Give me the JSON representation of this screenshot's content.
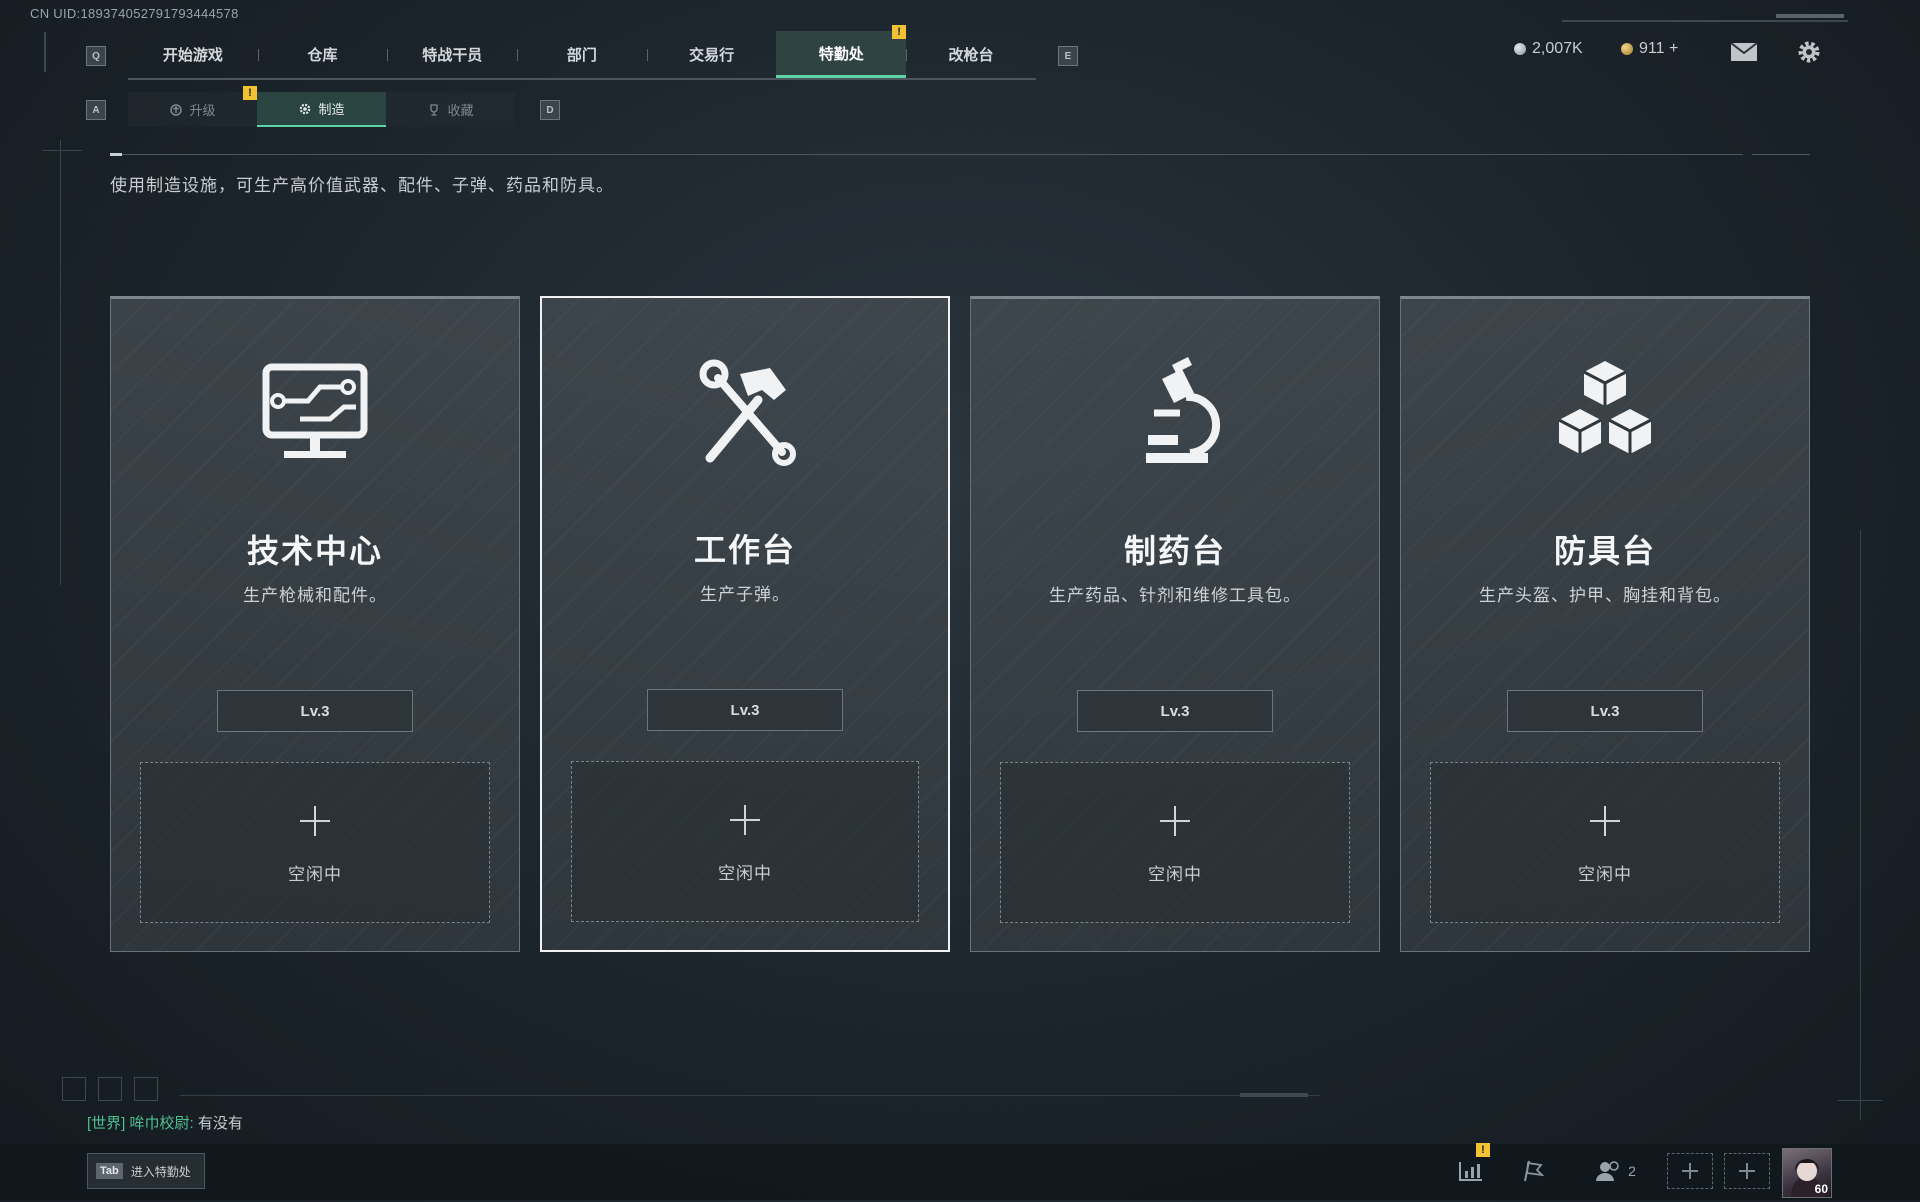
{
  "uid": "CN UID:189374052791793444578",
  "nav": {
    "left_key": "Q",
    "right_key": "E",
    "tabs": [
      "开始游戏",
      "仓库",
      "特战干员",
      "部门",
      "交易行",
      "特勤处",
      "改枪台"
    ],
    "active_index": 5,
    "alert_mark": "!"
  },
  "subnav": {
    "left_key": "A",
    "right_key": "D",
    "tabs": [
      {
        "label": "升级",
        "icon": "upgrade-icon"
      },
      {
        "label": "制造",
        "icon": "gear-icon"
      },
      {
        "label": "收藏",
        "icon": "trophy-icon"
      }
    ],
    "active_index": 1,
    "alert_mark": "!"
  },
  "currency": {
    "coins": "2,007K",
    "gold": "911 +",
    "coins_color": "#b9bec2",
    "gold_color": "#caa64a"
  },
  "description": "使用制造设施，可生产高价值武器、配件、子弹、药品和防具。",
  "stations": [
    {
      "title": "技术中心",
      "subtitle": "生产枪械和配件。",
      "level": "Lv.3",
      "slot_status": "空闲中",
      "icon": "computer-icon"
    },
    {
      "title": "工作台",
      "subtitle": "生产子弹。",
      "level": "Lv.3",
      "slot_status": "空闲中",
      "icon": "hammer-wrench-icon"
    },
    {
      "title": "制药台",
      "subtitle": "生产药品、针剂和维修工具包。",
      "level": "Lv.3",
      "slot_status": "空闲中",
      "icon": "microscope-icon"
    },
    {
      "title": "防具台",
      "subtitle": "生产头盔、护甲、胸挂和背包。",
      "level": "Lv.3",
      "slot_status": "空闲中",
      "icon": "boxes-icon"
    }
  ],
  "selected_station": 1,
  "chat": {
    "channel": "[世界]",
    "sender": "哞巾校尉:",
    "message": "有没有"
  },
  "bottom": {
    "tab_key": "Tab",
    "tab_label": "进入特勤处",
    "friends_count": "2",
    "player_level": "60",
    "alert_mark": "!"
  },
  "colors": {
    "accent": "#5fd1a6",
    "warning": "#f1c232",
    "chat_channel": "#4fbf8e"
  }
}
